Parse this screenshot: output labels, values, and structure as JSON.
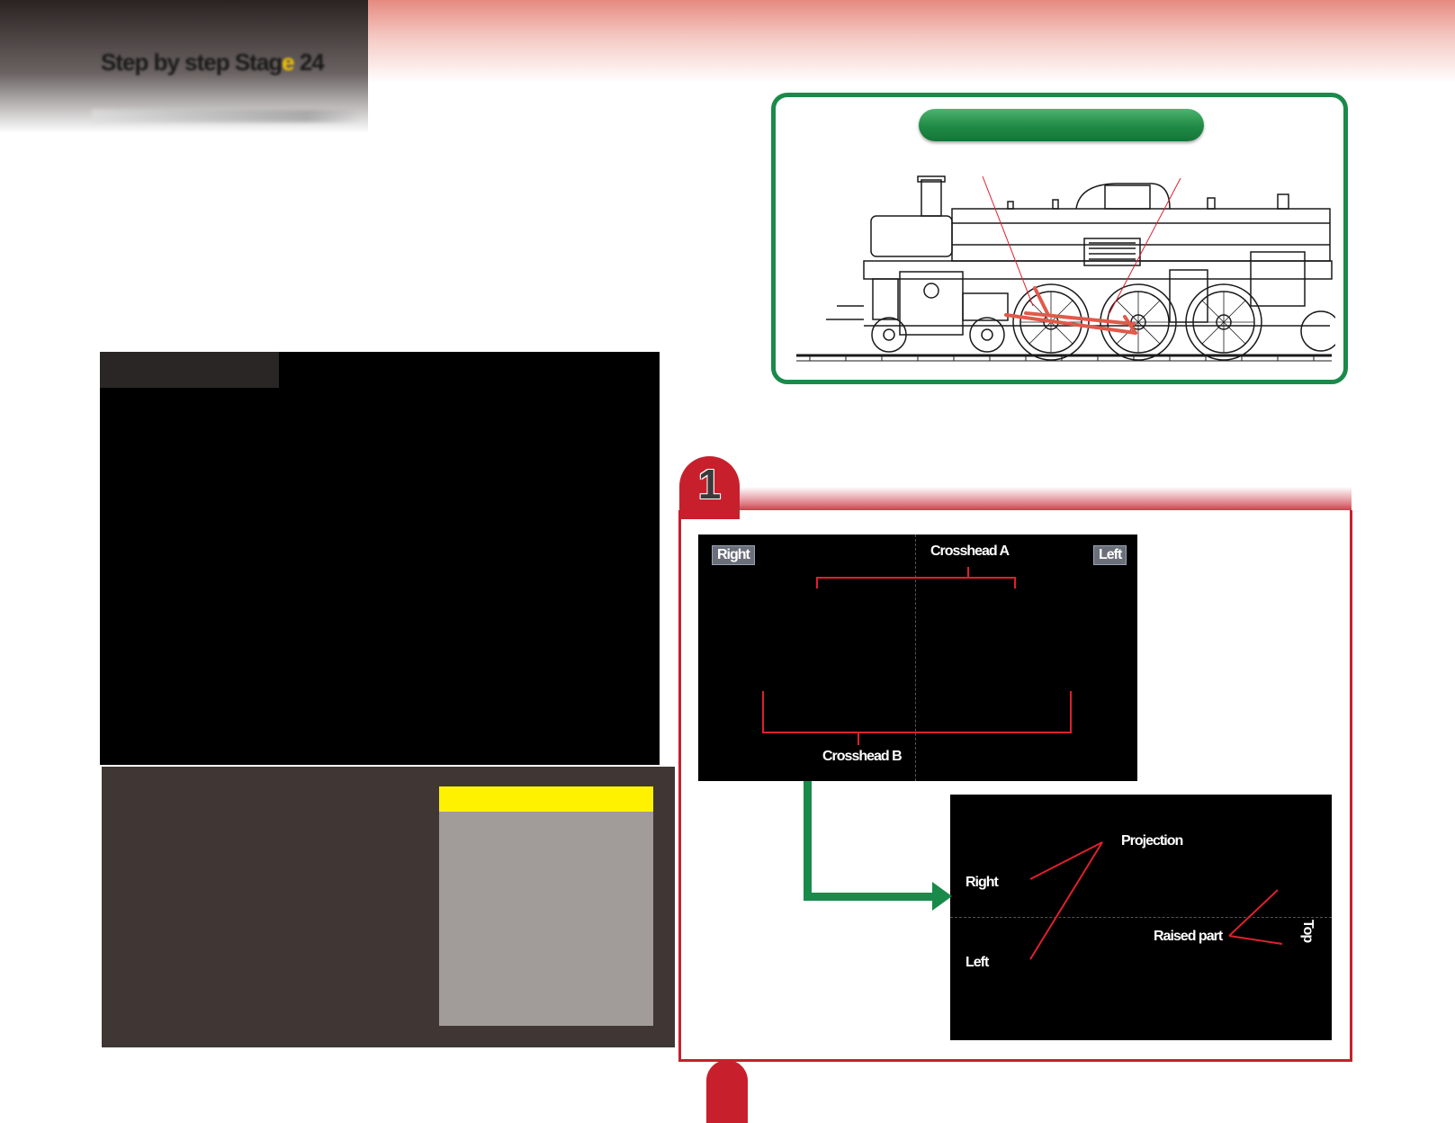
{
  "header": {
    "title_prefix": "Step by step Stag",
    "title_highlight": "e",
    "title_suffix": " 24"
  },
  "step": {
    "number": "1"
  },
  "labels": {
    "right_tag": "Right",
    "left_tag": "Left",
    "crosshead_a": "Crosshead A",
    "crosshead_b": "Crosshead B",
    "projection": "Projection",
    "right": "Right",
    "left": "Left",
    "raised_part": "Raised part",
    "top": "Top"
  },
  "colors": {
    "accent_red": "#c7202c",
    "accent_green": "#1a8a4a",
    "highlight_yellow": "#fff200",
    "dark_panel": "#403634"
  }
}
